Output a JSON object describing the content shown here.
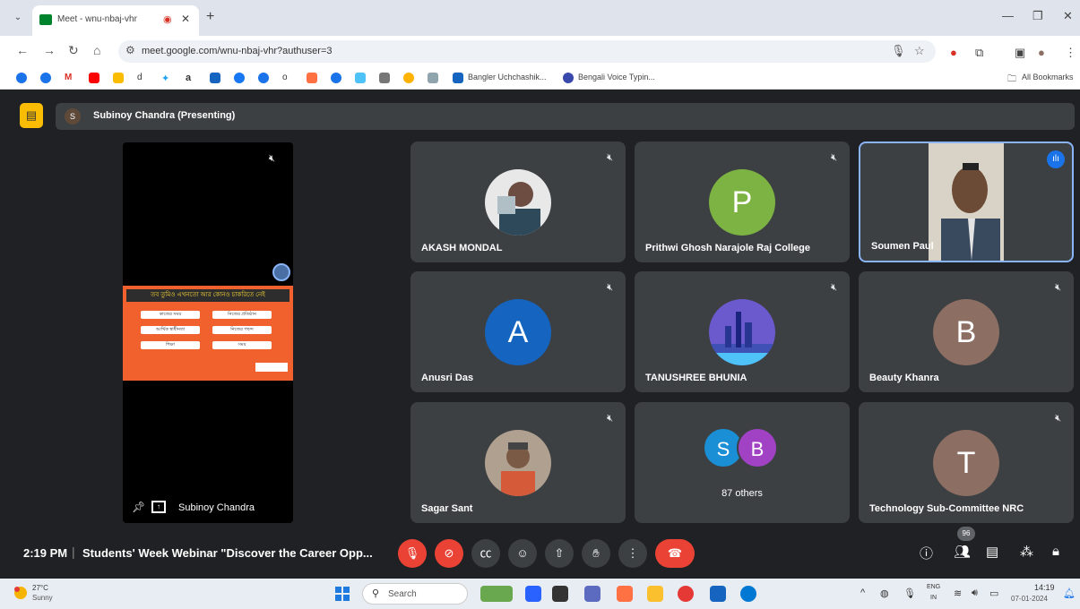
{
  "browser": {
    "tab_title": "Meet - wnu-nbaj-vhr",
    "url": "meet.google.com/wnu-nbaj-vhr?authuser=3",
    "bookmarks": [
      {
        "label": "Bangler Uchchashik..."
      },
      {
        "label": "Bengali Voice Typin..."
      }
    ],
    "all_bookmarks": "All Bookmarks"
  },
  "meet": {
    "presenting_initial": "S",
    "presenting_label": "Subinoy Chandra (Presenting)",
    "screen_share": {
      "presenter_name": "Subinoy Chandra",
      "slide_heading": "তব তুমিও এখনতো আর কোনও চাকরিতে নেই",
      "slide_items": [
        "কাজের সময়",
        "নিজের প্রতিষ্ঠান",
        "আর্থিক স্বাধীনতা",
        "নিজের পছন্দ",
        "শিক্ষা",
        "সময়"
      ]
    },
    "participants": [
      {
        "name": "AKASH MONDAL",
        "type": "photo"
      },
      {
        "name": "Prithwi Ghosh Narajole Raj College",
        "initial": "P",
        "color": "#7cb342"
      },
      {
        "name": "Soumen Paul",
        "type": "video"
      },
      {
        "name": "Anusri Das",
        "initial": "A",
        "color": "#1565c0"
      },
      {
        "name": "TANUSHREE BHUNIA",
        "type": "photo"
      },
      {
        "name": "Beauty Khanra",
        "initial": "B",
        "color": "#8d6e63"
      },
      {
        "name": "Sagar Sant",
        "type": "photo"
      },
      {
        "name": "87 others",
        "initials": [
          "S",
          "B"
        ]
      },
      {
        "name": "Technology Sub-Committee NRC",
        "initial": "T",
        "color": "#8d6e63"
      }
    ],
    "bottom": {
      "time": "2:19 PM",
      "meeting_title": "Students' Week Webinar \"Discover the Career Opp...",
      "people_count": "96"
    }
  },
  "taskbar": {
    "temp": "27°C",
    "condition": "Sunny",
    "search": "Search",
    "lang1": "ENG",
    "lang2": "IN",
    "clock_time": "14:19",
    "clock_date": "07-01-2024"
  }
}
